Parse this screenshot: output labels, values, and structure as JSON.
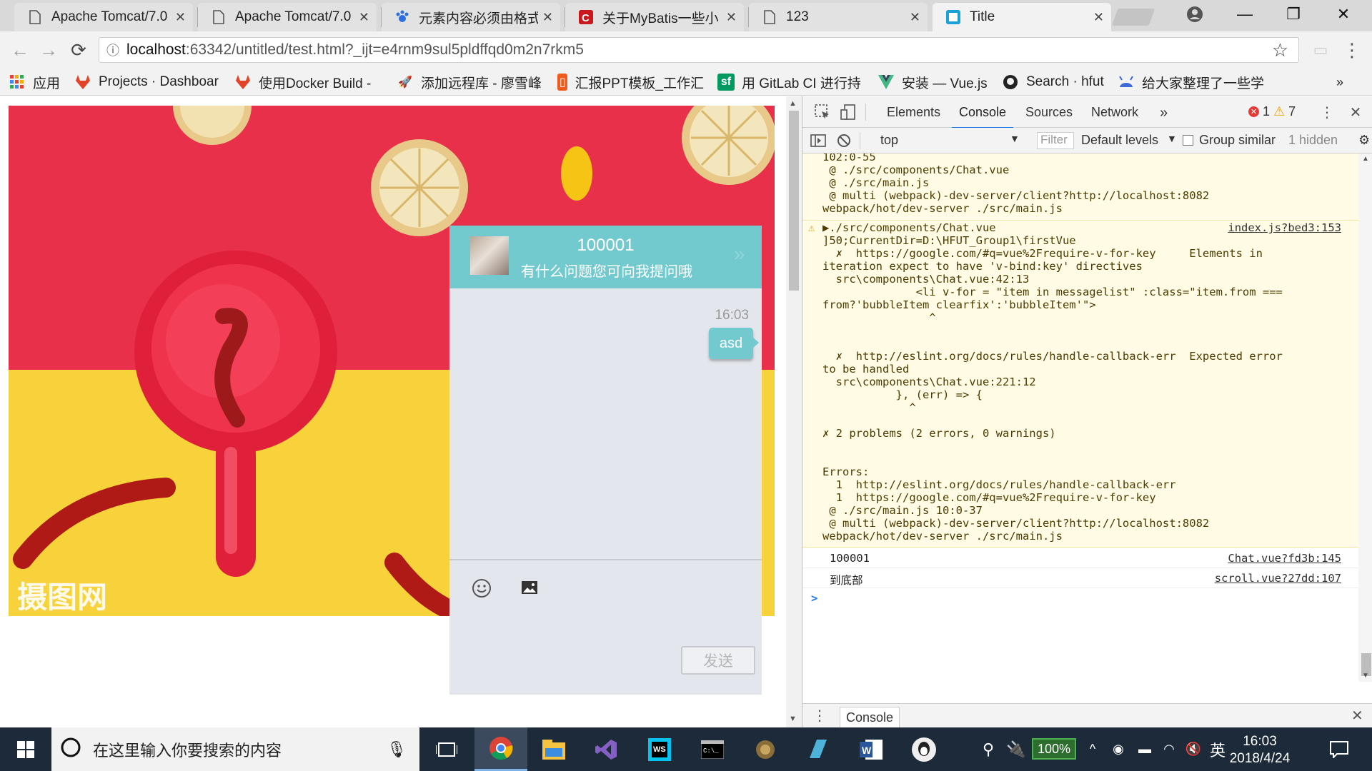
{
  "tabs": [
    {
      "title": "Apache Tomcat/7.0"
    },
    {
      "title": "Apache Tomcat/7.0"
    },
    {
      "title": "元素内容必须由格式"
    },
    {
      "title": "关于MyBatis一些小"
    },
    {
      "title": "123"
    },
    {
      "title": "Title"
    }
  ],
  "address": {
    "host": "localhost",
    "rest": ":63342/untitled/test.html?_ijt=e4rnm9sul5pldffqd0m2n7rkm5"
  },
  "bookmarks": [
    {
      "label": "应用"
    },
    {
      "label": "Projects · Dashboar"
    },
    {
      "label": "使用Docker Build -"
    },
    {
      "label": "添加远程库 - 廖雪峰"
    },
    {
      "label": "汇报PPT模板_工作汇"
    },
    {
      "label": "用 GitLab CI 进行持"
    },
    {
      "label": "安装 — Vue.js"
    },
    {
      "label": "Search · hfut"
    },
    {
      "label": "给大家整理了一些学"
    }
  ],
  "photo": {
    "watermark": "摄图网"
  },
  "chat": {
    "name": "100001",
    "subtitle": "有什么问题您可向我提问哦",
    "time": "16:03",
    "message": "asd",
    "send_label": "发送"
  },
  "devtools": {
    "tabs": [
      "Elements",
      "Console",
      "Sources",
      "Network"
    ],
    "errors": "1",
    "warnings": "7",
    "context": "top",
    "filter_placeholder": "Filter",
    "levels": "Default levels",
    "group_similar": "Group similar",
    "hidden": "1 hidden",
    "drawer_tab": "Console"
  },
  "console": {
    "block1": [
      "102:0-55",
      " @ ./src/components/Chat.vue",
      " @ ./src/main.js",
      " @ multi (webpack)-dev-server/client?http://localhost:8082",
      "webpack/hot/dev-server ./src/main.js"
    ],
    "block2_head": "▶./src/components/Chat.vue",
    "block2_src": "index.js?bed3:153",
    "block2": [
      "]50;CurrentDir=D:\\HFUT_Group1\\firstVue",
      "  ✗  https://google.com/#q=vue%2Frequire-v-for-key     Elements in",
      "iteration expect to have 'v-bind:key' directives",
      "  src\\components\\Chat.vue:42:13",
      "              <li v-for = \"item in messagelist\" :class=\"item.from ===",
      "from?'bubbleItem clearfix':'bubbleItem'\">",
      "                ^",
      "",
      "",
      "  ✗  http://eslint.org/docs/rules/handle-callback-err  Expected error",
      "to be handled",
      "  src\\components\\Chat.vue:221:12",
      "           }, (err) => {",
      "             ^",
      "",
      "",
      "",
      "✗ 2 problems (2 errors, 0 warnings)",
      "",
      "",
      "Errors:",
      "  1  http://eslint.org/docs/rules/handle-callback-err",
      "  1  https://google.com/#q=vue%2Frequire-v-for-key",
      " @ ./src/main.js 10:0-37",
      " @ multi (webpack)-dev-server/client?http://localhost:8082",
      "webpack/hot/dev-server ./src/main.js"
    ],
    "logs": [
      {
        "msg": "100001",
        "src": "Chat.vue?fd3b:145"
      },
      {
        "msg": "到底部",
        "src": "scroll.vue?27dd:107"
      }
    ],
    "prompt": ">"
  },
  "taskbar": {
    "search_placeholder": "在这里输入你要搜索的内容",
    "battery": "100%",
    "ime": "英",
    "time": "16:03",
    "date": "2018/4/24"
  }
}
